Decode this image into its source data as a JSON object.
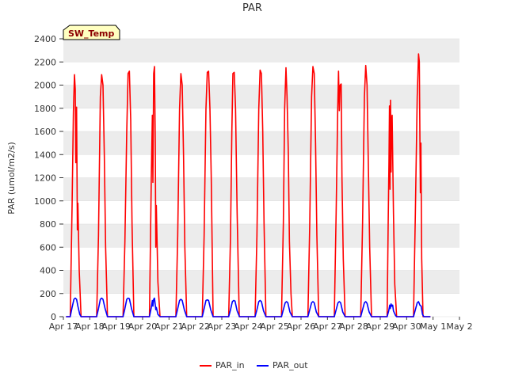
{
  "chart_data": {
    "type": "line",
    "title": "PAR",
    "ylabel": "PAR (umol/m2/s)",
    "xlabel": "",
    "ylim": [
      0,
      2400
    ],
    "yticks": [
      0,
      200,
      400,
      600,
      800,
      1000,
      1200,
      1400,
      1600,
      1800,
      2000,
      2200,
      2400
    ],
    "xticks": [
      "Apr 17",
      "Apr 18",
      "Apr 19",
      "Apr 20",
      "Apr 21",
      "Apr 22",
      "Apr 23",
      "Apr 24",
      "Apr 25",
      "Apr 26",
      "Apr 27",
      "Apr 28",
      "Apr 29",
      "Apr 30",
      "May 1",
      "May 2"
    ],
    "xlim_days": [
      0,
      15
    ],
    "grid": "horizontal bands",
    "badge": "SW_Temp",
    "legend_position": "bottom-center",
    "series": [
      {
        "name": "PAR_in",
        "color": "#ff0000",
        "daily_peaks": [
          2090,
          2090,
          2120,
          2160,
          2100,
          2120,
          2110,
          2130,
          2150,
          2160,
          2120,
          2170,
          1870,
          2270
        ],
        "points": [
          [
            0.26,
            0
          ],
          [
            0.33,
            960
          ],
          [
            0.38,
            1770
          ],
          [
            0.42,
            2090
          ],
          [
            0.45,
            1960
          ],
          [
            0.47,
            1330
          ],
          [
            0.5,
            1810
          ],
          [
            0.53,
            750
          ],
          [
            0.55,
            980
          ],
          [
            0.6,
            400
          ],
          [
            0.67,
            0
          ],
          [
            1.26,
            0
          ],
          [
            1.33,
            700
          ],
          [
            1.4,
            1900
          ],
          [
            1.45,
            2090
          ],
          [
            1.5,
            2000
          ],
          [
            1.55,
            1400
          ],
          [
            1.6,
            600
          ],
          [
            1.67,
            0
          ],
          [
            2.26,
            0
          ],
          [
            2.33,
            650
          ],
          [
            2.4,
            1600
          ],
          [
            2.45,
            2100
          ],
          [
            2.5,
            2120
          ],
          [
            2.55,
            1700
          ],
          [
            2.6,
            800
          ],
          [
            2.67,
            0
          ],
          [
            3.26,
            0
          ],
          [
            3.33,
            1200
          ],
          [
            3.37,
            1740
          ],
          [
            3.39,
            1160
          ],
          [
            3.42,
            2100
          ],
          [
            3.45,
            2160
          ],
          [
            3.48,
            1500
          ],
          [
            3.5,
            600
          ],
          [
            3.52,
            960
          ],
          [
            3.58,
            300
          ],
          [
            3.66,
            0
          ],
          [
            4.26,
            0
          ],
          [
            4.33,
            700
          ],
          [
            4.4,
            1800
          ],
          [
            4.45,
            2100
          ],
          [
            4.5,
            2000
          ],
          [
            4.55,
            1400
          ],
          [
            4.6,
            600
          ],
          [
            4.67,
            0
          ],
          [
            5.26,
            0
          ],
          [
            5.33,
            700
          ],
          [
            5.4,
            1800
          ],
          [
            5.45,
            2110
          ],
          [
            5.5,
            2120
          ],
          [
            5.55,
            1800
          ],
          [
            5.6,
            1200
          ],
          [
            5.67,
            0
          ],
          [
            6.26,
            0
          ],
          [
            6.33,
            700
          ],
          [
            6.38,
            1600
          ],
          [
            6.42,
            2100
          ],
          [
            6.47,
            2110
          ],
          [
            6.52,
            1800
          ],
          [
            6.58,
            900
          ],
          [
            6.66,
            0
          ],
          [
            7.26,
            0
          ],
          [
            7.33,
            700
          ],
          [
            7.4,
            1800
          ],
          [
            7.45,
            2130
          ],
          [
            7.5,
            2100
          ],
          [
            7.55,
            1600
          ],
          [
            7.6,
            800
          ],
          [
            7.67,
            0
          ],
          [
            8.26,
            0
          ],
          [
            8.33,
            800
          ],
          [
            8.38,
            1800
          ],
          [
            8.43,
            2150
          ],
          [
            8.47,
            1900
          ],
          [
            8.52,
            1400
          ],
          [
            8.56,
            650
          ],
          [
            8.62,
            200
          ],
          [
            8.67,
            0
          ],
          [
            9.26,
            0
          ],
          [
            9.33,
            800
          ],
          [
            9.4,
            1900
          ],
          [
            9.45,
            2160
          ],
          [
            9.5,
            2100
          ],
          [
            9.55,
            1500
          ],
          [
            9.6,
            700
          ],
          [
            9.67,
            0
          ],
          [
            10.26,
            0
          ],
          [
            10.33,
            900
          ],
          [
            10.39,
            1800
          ],
          [
            10.42,
            2120
          ],
          [
            10.45,
            1780
          ],
          [
            10.48,
            2000
          ],
          [
            10.52,
            2010
          ],
          [
            10.55,
            1200
          ],
          [
            10.6,
            500
          ],
          [
            10.67,
            0
          ],
          [
            11.26,
            0
          ],
          [
            11.33,
            800
          ],
          [
            11.4,
            1900
          ],
          [
            11.45,
            2170
          ],
          [
            11.5,
            2000
          ],
          [
            11.55,
            1300
          ],
          [
            11.6,
            600
          ],
          [
            11.67,
            0
          ],
          [
            12.26,
            0
          ],
          [
            12.3,
            800
          ],
          [
            12.33,
            1340
          ],
          [
            12.35,
            1820
          ],
          [
            12.37,
            1100
          ],
          [
            12.39,
            1870
          ],
          [
            12.41,
            1250
          ],
          [
            12.43,
            1700
          ],
          [
            12.45,
            1740
          ],
          [
            12.5,
            900
          ],
          [
            12.55,
            280
          ],
          [
            12.62,
            0
          ],
          [
            13.26,
            0
          ],
          [
            13.33,
            900
          ],
          [
            13.4,
            1900
          ],
          [
            13.45,
            2270
          ],
          [
            13.48,
            2200
          ],
          [
            13.5,
            1600
          ],
          [
            13.52,
            1070
          ],
          [
            13.54,
            1500
          ],
          [
            13.57,
            500
          ],
          [
            13.62,
            0
          ]
        ]
      },
      {
        "name": "PAR_out",
        "color": "#0000ff",
        "daily_peaks": [
          160,
          160,
          160,
          160,
          150,
          145,
          140,
          140,
          130,
          130,
          130,
          130,
          110,
          130
        ],
        "points": [
          [
            0.26,
            0
          ],
          [
            0.33,
            80
          ],
          [
            0.4,
            150
          ],
          [
            0.45,
            160
          ],
          [
            0.5,
            150
          ],
          [
            0.55,
            90
          ],
          [
            0.62,
            20
          ],
          [
            0.67,
            0
          ],
          [
            1.26,
            0
          ],
          [
            1.33,
            70
          ],
          [
            1.4,
            150
          ],
          [
            1.45,
            160
          ],
          [
            1.5,
            150
          ],
          [
            1.58,
            70
          ],
          [
            1.67,
            0
          ],
          [
            2.26,
            0
          ],
          [
            2.33,
            70
          ],
          [
            2.4,
            150
          ],
          [
            2.45,
            160
          ],
          [
            2.5,
            155
          ],
          [
            2.58,
            70
          ],
          [
            2.67,
            0
          ],
          [
            3.26,
            0
          ],
          [
            3.33,
            80
          ],
          [
            3.37,
            140
          ],
          [
            3.39,
            90
          ],
          [
            3.42,
            150
          ],
          [
            3.45,
            160
          ],
          [
            3.5,
            60
          ],
          [
            3.52,
            80
          ],
          [
            3.58,
            20
          ],
          [
            3.66,
            0
          ],
          [
            4.26,
            0
          ],
          [
            4.33,
            70
          ],
          [
            4.4,
            140
          ],
          [
            4.45,
            150
          ],
          [
            4.5,
            140
          ],
          [
            4.58,
            60
          ],
          [
            4.67,
            0
          ],
          [
            5.26,
            0
          ],
          [
            5.33,
            70
          ],
          [
            5.4,
            140
          ],
          [
            5.45,
            145
          ],
          [
            5.5,
            140
          ],
          [
            5.58,
            60
          ],
          [
            5.67,
            0
          ],
          [
            6.26,
            0
          ],
          [
            6.33,
            60
          ],
          [
            6.4,
            130
          ],
          [
            6.45,
            140
          ],
          [
            6.5,
            135
          ],
          [
            6.58,
            50
          ],
          [
            6.67,
            0
          ],
          [
            7.26,
            0
          ],
          [
            7.33,
            60
          ],
          [
            7.4,
            130
          ],
          [
            7.45,
            140
          ],
          [
            7.5,
            130
          ],
          [
            7.58,
            50
          ],
          [
            7.67,
            0
          ],
          [
            8.26,
            0
          ],
          [
            8.33,
            60
          ],
          [
            8.4,
            120
          ],
          [
            8.45,
            130
          ],
          [
            8.5,
            120
          ],
          [
            8.58,
            40
          ],
          [
            8.67,
            0
          ],
          [
            9.26,
            0
          ],
          [
            9.33,
            60
          ],
          [
            9.4,
            120
          ],
          [
            9.45,
            130
          ],
          [
            9.5,
            120
          ],
          [
            9.58,
            40
          ],
          [
            9.67,
            0
          ],
          [
            10.26,
            0
          ],
          [
            10.33,
            60
          ],
          [
            10.4,
            120
          ],
          [
            10.45,
            130
          ],
          [
            10.5,
            120
          ],
          [
            10.58,
            40
          ],
          [
            10.67,
            0
          ],
          [
            11.26,
            0
          ],
          [
            11.33,
            60
          ],
          [
            11.4,
            120
          ],
          [
            11.45,
            130
          ],
          [
            11.5,
            115
          ],
          [
            11.58,
            40
          ],
          [
            11.67,
            0
          ],
          [
            12.26,
            0
          ],
          [
            12.32,
            50
          ],
          [
            12.36,
            100
          ],
          [
            12.38,
            70
          ],
          [
            12.41,
            110
          ],
          [
            12.44,
            90
          ],
          [
            12.47,
            100
          ],
          [
            12.5,
            50
          ],
          [
            12.58,
            10
          ],
          [
            12.62,
            0
          ],
          [
            13.26,
            0
          ],
          [
            13.33,
            60
          ],
          [
            13.4,
            120
          ],
          [
            13.45,
            130
          ],
          [
            13.5,
            100
          ],
          [
            13.55,
            90
          ],
          [
            13.6,
            20
          ],
          [
            13.65,
            0
          ]
        ]
      }
    ]
  }
}
